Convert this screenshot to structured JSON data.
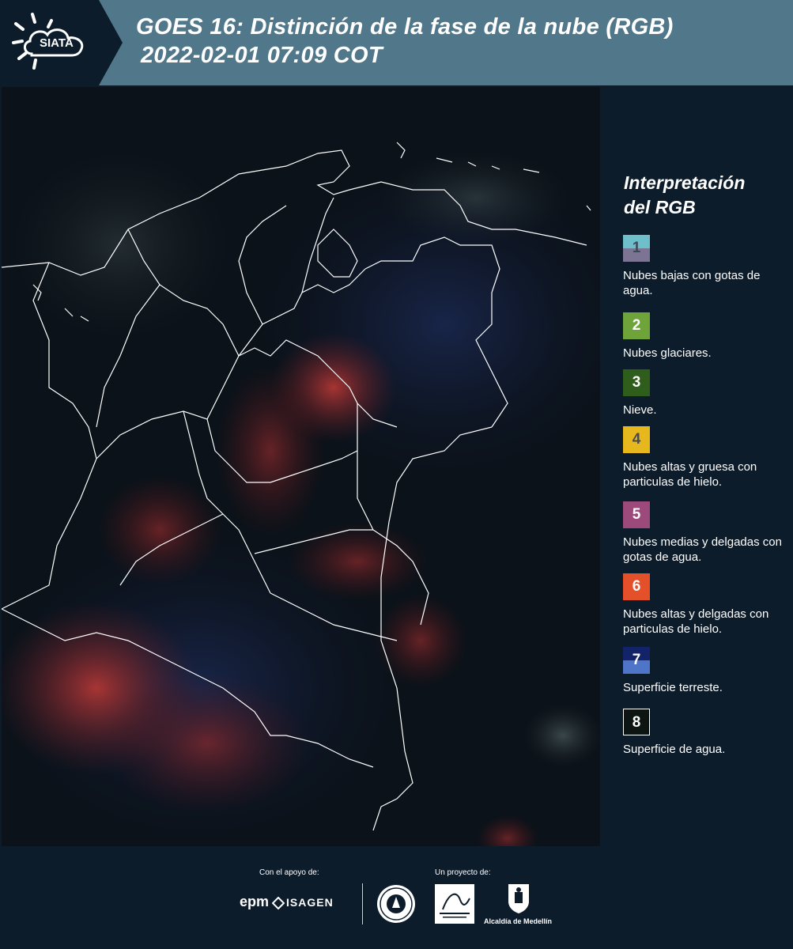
{
  "header": {
    "logo_text": "SIATA",
    "title_line1": "GOES 16: Distinción de la fase de la nube (RGB)",
    "title_line2": "2022-02-01 07:09 COT"
  },
  "legend": {
    "title_line1": "Interpretación",
    "title_line2": "del RGB",
    "items": [
      {
        "num": "1",
        "desc": "Nubes bajas con gotas de agua.",
        "color_top": "#6fbfca",
        "color_bottom": "#7b7593",
        "num_color": "#3b4a5a"
      },
      {
        "num": "2",
        "desc": "Nubes glaciares.",
        "color_top": "#6ea43a",
        "color_bottom": "#6ea43a",
        "num_color": "#ffffff"
      },
      {
        "num": "3",
        "desc": "Nieve.",
        "color_top": "#2f5d1c",
        "color_bottom": "#2f5d1c",
        "num_color": "#ffffff"
      },
      {
        "num": "4",
        "desc": "Nubes altas y gruesa con particulas de hielo.",
        "color_top": "#e6b81e",
        "color_bottom": "#e6b81e",
        "num_color": "#4a4a4a"
      },
      {
        "num": "5",
        "desc": "Nubes medias y delgadas con gotas de agua.",
        "color_top": "#9c4a7c",
        "color_bottom": "#9c4a7c",
        "num_color": "#ffffff"
      },
      {
        "num": "6",
        "desc": "Nubes altas y delgadas con particulas de hielo.",
        "color_top": "#e3502a",
        "color_bottom": "#e3502a",
        "num_color": "#ffffff"
      },
      {
        "num": "7",
        "desc": "Superficie terreste.",
        "color_top": "#13236a",
        "color_bottom": "#4f75c9",
        "num_color": "#ffffff"
      },
      {
        "num": "8",
        "desc": "Superficie de agua.",
        "color_top": "#0c1512",
        "color_bottom": "#0c1512",
        "num_color": "#ffffff"
      }
    ]
  },
  "footer": {
    "support_label": "Con el apoyo de:",
    "project_label": "Un proyecto de:",
    "epm": "epm",
    "isagen": "ISAGEN",
    "alcaldia": "Alcaldía de Medellín"
  }
}
